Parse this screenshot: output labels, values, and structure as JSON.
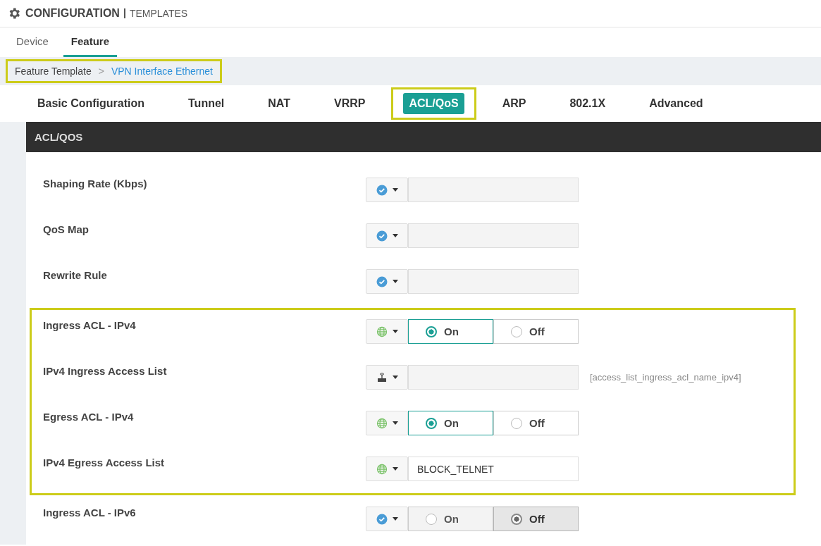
{
  "header": {
    "title": "CONFIGURATION",
    "subtitle": "TEMPLATES"
  },
  "top_tabs": [
    {
      "label": "Device",
      "selected": false
    },
    {
      "label": "Feature",
      "selected": true
    }
  ],
  "breadcrumb": {
    "highlighted": true,
    "items": [
      {
        "label": "Feature Template",
        "kind": "plain"
      },
      {
        "label": ">",
        "kind": "separator"
      },
      {
        "label": "VPN Interface Ethernet",
        "kind": "link"
      }
    ]
  },
  "section_tabs": [
    {
      "label": "Basic Configuration",
      "selected": false,
      "highlighted": false
    },
    {
      "label": "Tunnel",
      "selected": false,
      "highlighted": false
    },
    {
      "label": "NAT",
      "selected": false,
      "highlighted": false
    },
    {
      "label": "VRRP",
      "selected": false,
      "highlighted": false
    },
    {
      "label": "ACL/QoS",
      "selected": true,
      "highlighted": true
    },
    {
      "label": "ARP",
      "selected": false,
      "highlighted": false
    },
    {
      "label": "802.1X",
      "selected": false,
      "highlighted": false
    },
    {
      "label": "Advanced",
      "selected": false,
      "highlighted": false
    }
  ],
  "panel": {
    "title": "ACL/QOS",
    "row_groups": [
      {
        "highlighted": false,
        "rows": [
          {
            "label": "Shaping Rate (Kbps)",
            "kind": "text",
            "scope": {
              "kind": "default"
            }
          },
          {
            "label": "QoS Map",
            "kind": "text",
            "scope": {
              "kind": "default"
            }
          },
          {
            "label": "Rewrite Rule",
            "kind": "text",
            "scope": {
              "kind": "default"
            }
          }
        ]
      },
      {
        "highlighted": true,
        "rows": [
          {
            "label": "Ingress ACL - IPv4",
            "kind": "radio",
            "scope": {
              "kind": "global"
            },
            "options": [
              {
                "label": "On",
                "selected": true
              },
              {
                "label": "Off",
                "selected": false
              }
            ]
          },
          {
            "label": "IPv4 Ingress Access List",
            "kind": "text",
            "scope": {
              "kind": "device"
            },
            "hint": "[access_list_ingress_acl_name_ipv4]"
          },
          {
            "label": "Egress ACL - IPv4",
            "kind": "radio",
            "scope": {
              "kind": "global"
            },
            "options": [
              {
                "label": "On",
                "selected": true
              },
              {
                "label": "Off",
                "selected": false
              }
            ]
          },
          {
            "label": "IPv4 Egress Access List",
            "kind": "text",
            "scope": {
              "kind": "global"
            },
            "value": "BLOCK_TELNET"
          }
        ]
      },
      {
        "highlighted": false,
        "rows": [
          {
            "label": "Ingress ACL - IPv6",
            "kind": "radio",
            "scope": {
              "kind": "default"
            },
            "options": [
              {
                "label": "On",
                "selected": false
              },
              {
                "label": "Off",
                "selected": true
              }
            ]
          }
        ]
      }
    ]
  }
}
